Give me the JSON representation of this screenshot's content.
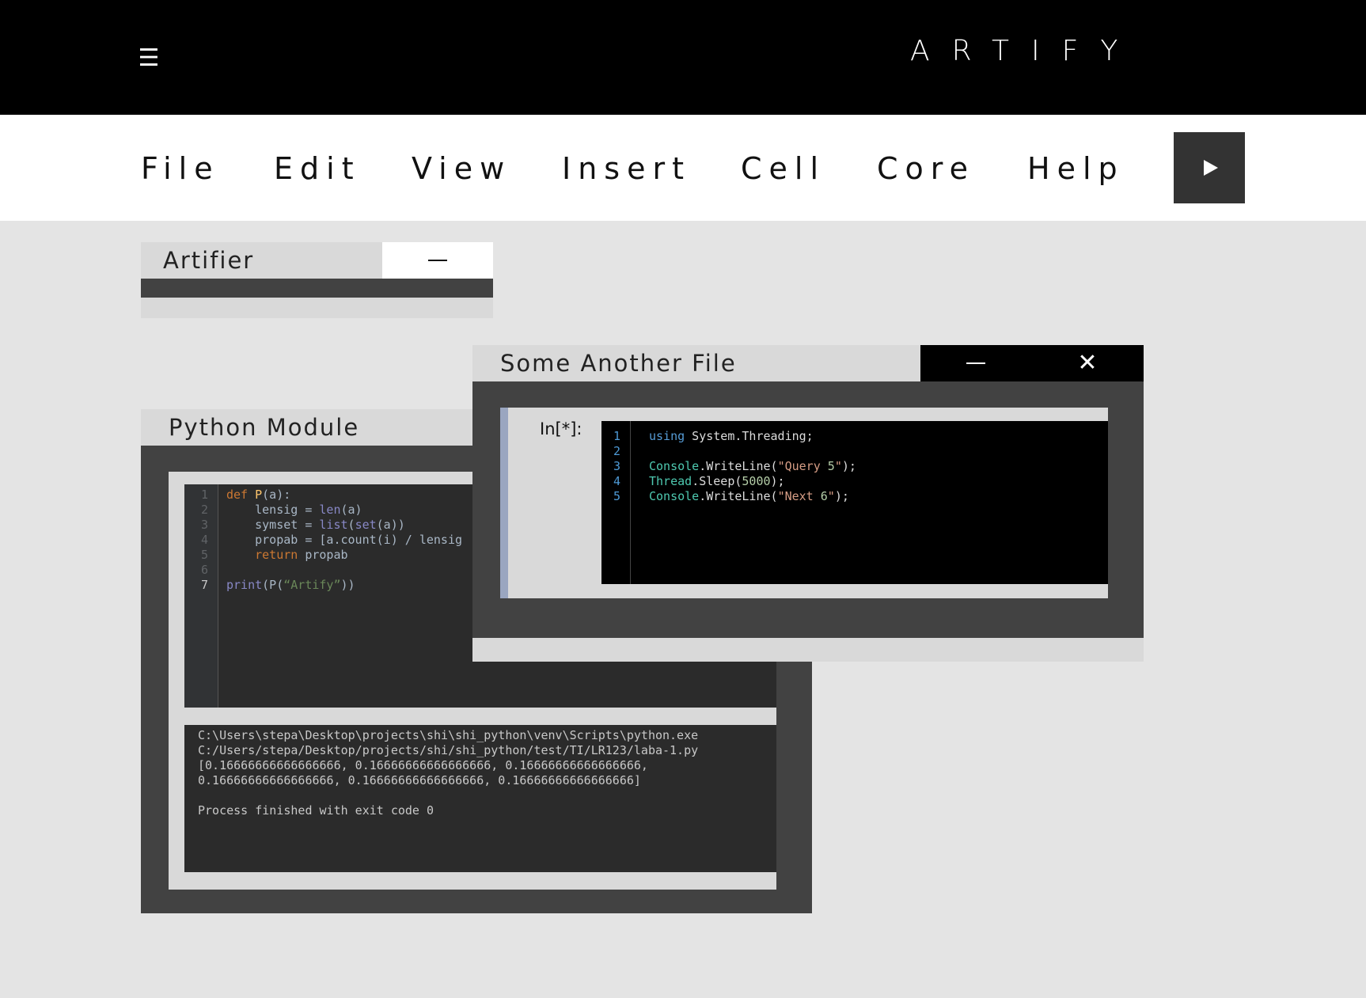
{
  "header": {
    "brand": "ARTIFY",
    "menu_icon": "hamburger-icon"
  },
  "menu": {
    "items": [
      "File",
      "Edit",
      "View",
      "Insert",
      "Cell",
      "Core",
      "Help"
    ],
    "run_icon": "play-icon"
  },
  "windows": {
    "artifier": {
      "title": "Artifier",
      "minimize_icon": "minimize-icon"
    },
    "python_module": {
      "title": "Python Module",
      "editor": {
        "line_numbers": [
          "1",
          "2",
          "3",
          "4",
          "5",
          "6",
          "7"
        ],
        "lines": [
          "def P(a):",
          "    lensig = len(a)",
          "    symset = list(set(a))",
          "    propab = [a.count(i) / lensig",
          "    return propab",
          "",
          "print(P(“Artify”))"
        ]
      },
      "console": [
        "C:\\Users\\stepa\\Desktop\\projects\\shi\\shi_python\\venv\\Scripts\\python.exe",
        "C:/Users/stepa/Desktop/projects/shi/shi_python/test/TI/LR123/laba-1.py",
        "[0.16666666666666666, 0.16666666666666666, 0.16666666666666666,",
        "0.16666666666666666, 0.16666666666666666, 0.16666666666666666]",
        "",
        "Process finished with exit code 0"
      ]
    },
    "some_another_file": {
      "title": "Some Another File",
      "minimize_icon": "minimize-icon",
      "close_icon": "close-icon",
      "prompt": "In[*]:",
      "editor": {
        "line_numbers": [
          "1",
          "2",
          "3",
          "4",
          "5"
        ],
        "lines": [
          "using System.Threading;",
          "",
          "Console.WriteLine(\"Query 5\");",
          "Thread.Sleep(5000);",
          "Console.WriteLine(\"Next 6\");"
        ]
      }
    }
  },
  "colors": {
    "topbar": "#000000",
    "background": "#e4e4e4",
    "window_body": "#424242",
    "titlebar": "#d9d9d9"
  }
}
